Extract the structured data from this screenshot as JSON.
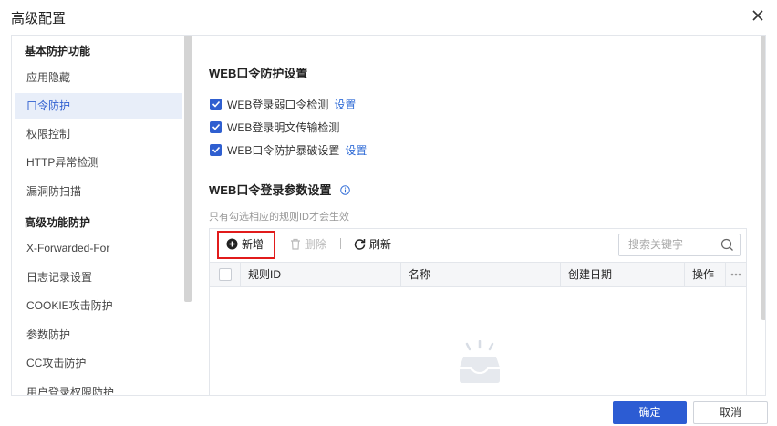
{
  "dialog": {
    "title": "高级配置",
    "ok_label": "确定",
    "cancel_label": "取消"
  },
  "sidebar": {
    "group1": "基本防护功能",
    "items_basic": [
      "应用隐藏",
      "口令防护",
      "权限控制",
      "HTTP异常检测",
      "漏洞防扫描"
    ],
    "group2": "高级功能防护",
    "items_advanced": [
      "X-Forwarded-For",
      "日志记录设置",
      "COOKIE攻击防护",
      "参数防护",
      "CC攻击防护",
      "用户登录权限防护"
    ],
    "active_item": "口令防护"
  },
  "section1": {
    "title": "WEB口令防护设置",
    "options": [
      {
        "label": "WEB登录弱口令检测",
        "checked": true,
        "link": "设置"
      },
      {
        "label": "WEB登录明文传输检测",
        "checked": true,
        "link": ""
      },
      {
        "label": "WEB口令防护暴破设置",
        "checked": true,
        "link": "设置"
      }
    ]
  },
  "section2": {
    "title": "WEB口令登录参数设置",
    "hint": "只有勾选相应的规则ID才会生效",
    "toolbar": {
      "add_label": "新增",
      "delete_label": "删除",
      "refresh_label": "刷新",
      "search_placeholder": "搜索关键字"
    },
    "columns": [
      "规则ID",
      "名称",
      "创建日期",
      "操作"
    ]
  },
  "colors": {
    "accent": "#2c5cd3",
    "highlight_border": "#e11b1b",
    "active_bg": "#e8eef9"
  }
}
